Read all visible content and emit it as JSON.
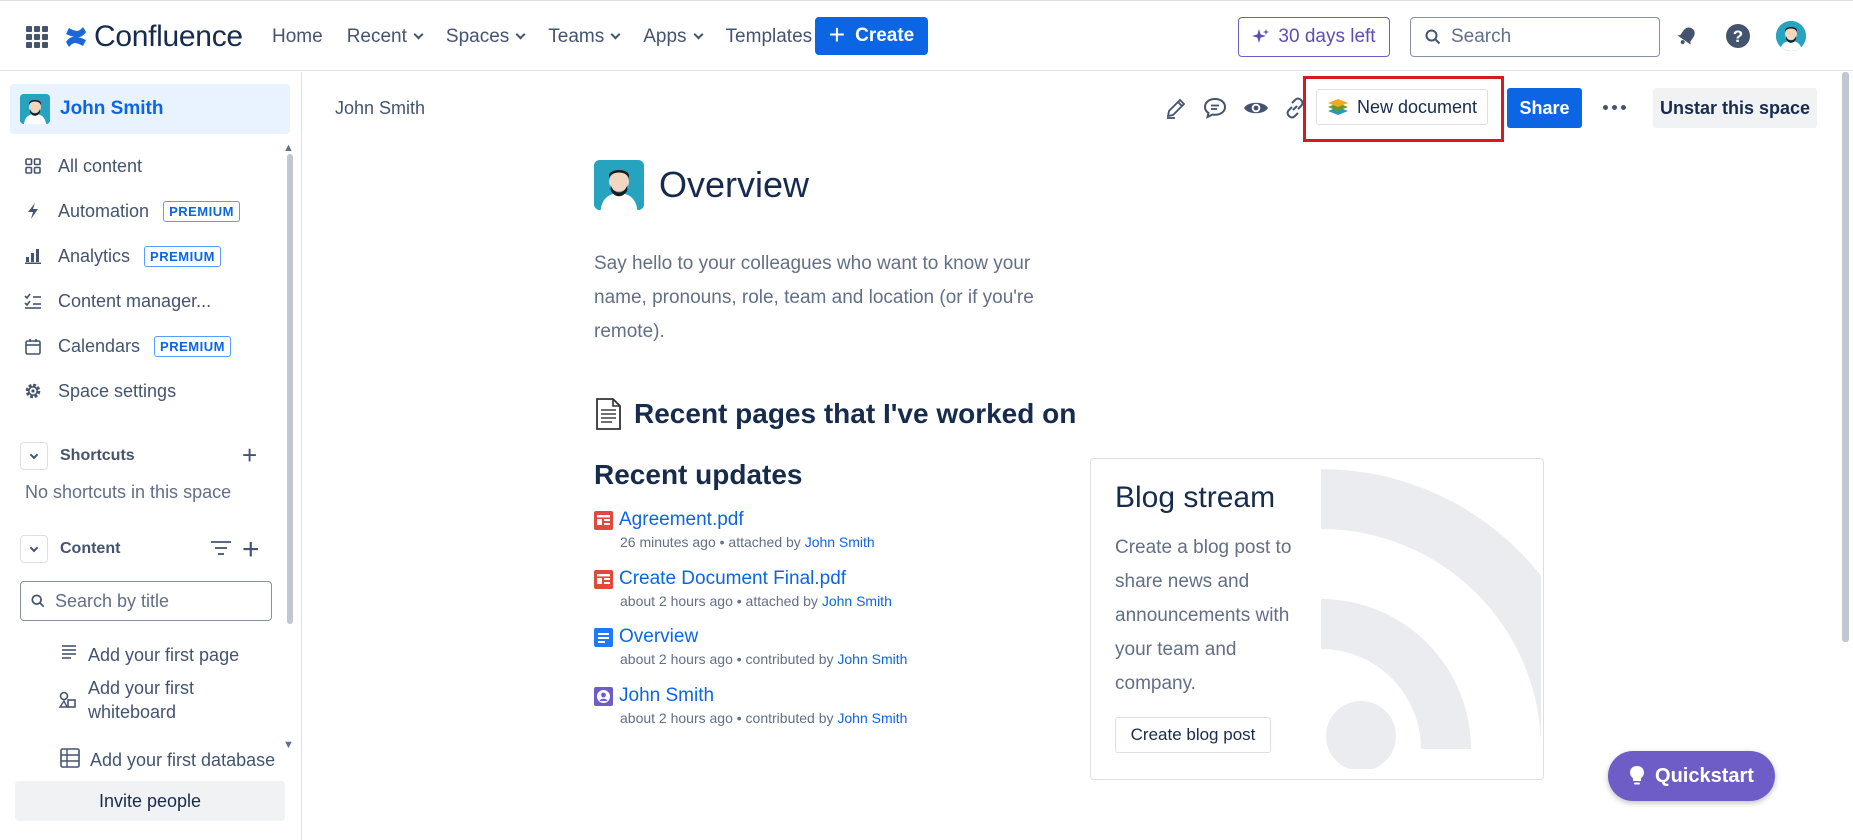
{
  "topnav": {
    "logo_text": "Confluence",
    "links": [
      {
        "label": "Home",
        "dropdown": false
      },
      {
        "label": "Recent",
        "dropdown": true
      },
      {
        "label": "Spaces",
        "dropdown": true
      },
      {
        "label": "Teams",
        "dropdown": true
      },
      {
        "label": "Apps",
        "dropdown": true
      },
      {
        "label": "Templates",
        "dropdown": false
      }
    ],
    "create_label": "Create",
    "trial_label": "30 days left",
    "search_placeholder": "Search"
  },
  "sidebar": {
    "space_name": "John Smith",
    "items": [
      {
        "label": "All content",
        "icon": "grid-icon",
        "badge": ""
      },
      {
        "label": "Automation",
        "icon": "lightning-icon",
        "badge": "PREMIUM"
      },
      {
        "label": "Analytics",
        "icon": "bar-chart-icon",
        "badge": "PREMIUM"
      },
      {
        "label": "Content manager...",
        "icon": "checklist-icon",
        "badge": ""
      },
      {
        "label": "Calendars",
        "icon": "calendar-icon",
        "badge": "PREMIUM"
      },
      {
        "label": "Space settings",
        "icon": "gear-icon",
        "badge": ""
      }
    ],
    "shortcuts_label": "Shortcuts",
    "shortcuts_empty": "No shortcuts in this space",
    "content_label": "Content",
    "search_placeholder": "Search by title",
    "tree": [
      {
        "label": "Add your first page",
        "icon": "page-icon"
      },
      {
        "label": "Add your first whiteboard",
        "icon": "whiteboard-icon"
      },
      {
        "label": "Add your first database",
        "icon": "database-icon"
      }
    ],
    "invite_label": "Invite people"
  },
  "toolbar": {
    "breadcrumb": "John Smith",
    "new_document_label": "New document",
    "share_label": "Share",
    "unstar_label": "Unstar this space"
  },
  "page": {
    "title": "Overview",
    "intro": "Say hello to your colleagues who want to know your name, pronouns, role, team and location (or if you're remote).",
    "recent_pages_heading": "Recent pages that I've worked on",
    "recent_updates_heading": "Recent updates",
    "updates": [
      {
        "title": "Agreement.pdf",
        "meta": "26 minutes ago • attached by",
        "who": "John Smith",
        "icon": "pdf-icon",
        "color": "#e2483d"
      },
      {
        "title": "Create Document Final.pdf",
        "meta": "about 2 hours ago • attached by",
        "who": "John Smith",
        "icon": "pdf-icon",
        "color": "#e2483d"
      },
      {
        "title": "Overview",
        "meta": "about 2 hours ago • contributed by",
        "who": "John Smith",
        "icon": "page-icon",
        "color": "#1d7afc"
      },
      {
        "title": "John Smith",
        "meta": "about 2 hours ago • contributed by",
        "who": "John Smith",
        "icon": "profile-icon",
        "color": "#6e5dc6"
      }
    ],
    "blog": {
      "title": "Blog stream",
      "text": "Create a blog post to share news and announcements with your team and company.",
      "button": "Create blog post"
    }
  },
  "quickstart_label": "Quickstart",
  "colors": {
    "brand": "#0c66e4",
    "premium": "#0c66e4",
    "trial": "#6e5dc6",
    "highlight": "#d71920"
  }
}
